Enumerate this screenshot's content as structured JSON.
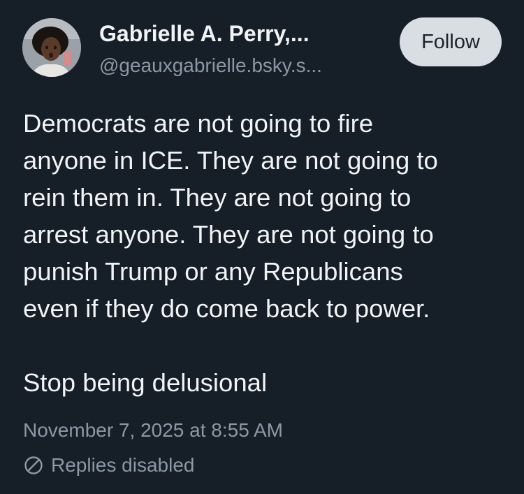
{
  "author": {
    "display_name": "Gabrielle A. Perry,...",
    "handle": "@geauxgabrielle.bsky.s..."
  },
  "follow_label": "Follow",
  "post": {
    "lines_para1": [
      "Democrats are not going to fire",
      "anyone in ICE. They are not going to",
      "rein them in. They are not going to",
      "arrest anyone. They are not going to",
      "punish Trump or any Republicans",
      "even if they do come back to power."
    ],
    "line_para2": "Stop being delusional"
  },
  "timestamp": "November 7, 2025 at 8:55 AM",
  "replies_status": "Replies disabled",
  "colors": {
    "background": "#161e27",
    "text": "#f1f3f5",
    "muted": "#8b98a5",
    "follow_bg": "#d9dee3"
  },
  "icons": {
    "replies_disabled": "prohibited-circle-icon"
  }
}
